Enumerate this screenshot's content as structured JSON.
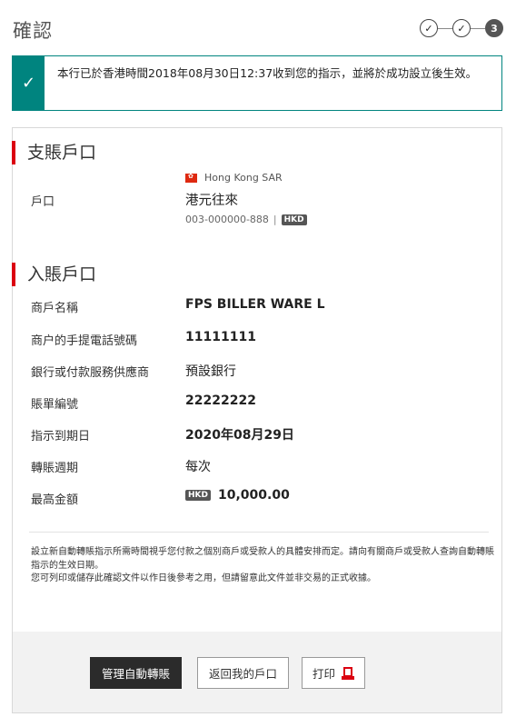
{
  "header": {
    "title": "確認",
    "steps": [
      {
        "state": "done",
        "glyph": "✓"
      },
      {
        "state": "done",
        "glyph": "✓"
      },
      {
        "state": "current",
        "glyph": "3"
      }
    ]
  },
  "alert": {
    "icon": "checkmark-icon",
    "color": "#00847f",
    "message": "本行已於香港時間2018年08月30日12:37收到您的指示，並將於成功設立後生效。"
  },
  "source": {
    "heading": "支賬戶口",
    "region": "Hong Kong SAR",
    "label": "戶口",
    "account_name": "港元往來",
    "account_number": "003-000000-888",
    "separator": "|",
    "currency": "HKD"
  },
  "destination": {
    "heading": "入賬戶口",
    "rows": [
      {
        "label": "商戶名稱",
        "value": "FPS BILLER WARE L"
      },
      {
        "label": "商户的手提電話號碼",
        "value": "11111111"
      },
      {
        "label": "銀行或付款服務供應商",
        "value": "預設銀行"
      },
      {
        "label": "賬單編號",
        "value": "22222222"
      },
      {
        "label": "指示到期日",
        "value": "2020年08月29日"
      },
      {
        "label": "轉賬週期",
        "value": "每次"
      },
      {
        "label": "最高金額",
        "value": "10,000.00",
        "currency": "HKD"
      }
    ]
  },
  "notes": {
    "line1": "設立新自動轉賬指示所需時間視乎您付款之個別商戶或受款人的具體安排而定。請向有關商戶或受款人查詢自動轉賬指示的生效日期。",
    "line2": "您可列印或儲存此確認文件以作日後參考之用，但請留意此文件並非交易的正式收據。"
  },
  "actions": {
    "manage_label": "管理自動轉賬",
    "back_label": "返回我的戶口",
    "print_label": "打印",
    "print_icon": "pdf-icon"
  },
  "colors": {
    "accent_red": "#db0011",
    "success_green": "#00847f",
    "primary_button": "#2b2b2b"
  }
}
